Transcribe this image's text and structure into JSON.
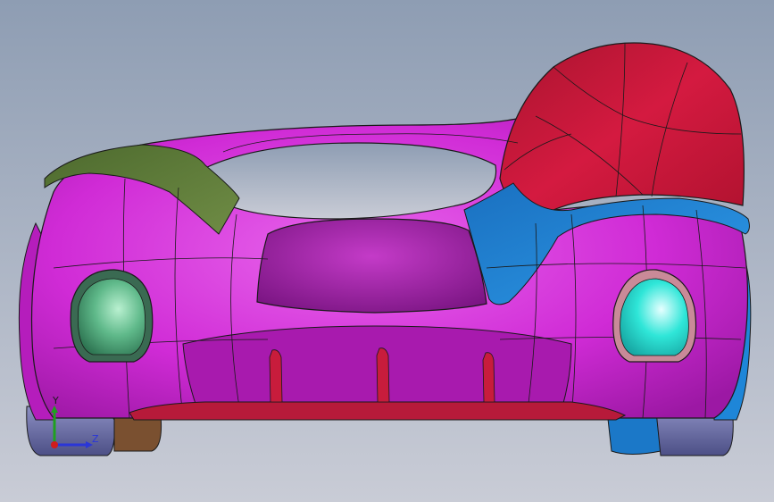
{
  "viewport": {
    "background_top": "#8e9db3",
    "background_bottom": "#c9ccd6"
  },
  "model": {
    "body_color": "#d02bd6",
    "body_highlight": "#f070f2",
    "body_shadow": "#a015a6",
    "hood_color": "#c8183a",
    "side_panel_color": "#1e86d8",
    "left_panel_color": "#5d7a3a",
    "left_light_color": "#5fb98a",
    "right_light_color": "#2fe6d8",
    "splitter_color": "#b71a3a",
    "edge_color": "#1a1a1a",
    "wheel_color": "#6a6fa8",
    "right_wheel_color": "#1b78c8"
  },
  "triad": {
    "y_label": "Y",
    "z_label": "Z",
    "y_color": "#1fa01f",
    "z_color": "#2a36d8",
    "x_color": "#d01c1c"
  }
}
